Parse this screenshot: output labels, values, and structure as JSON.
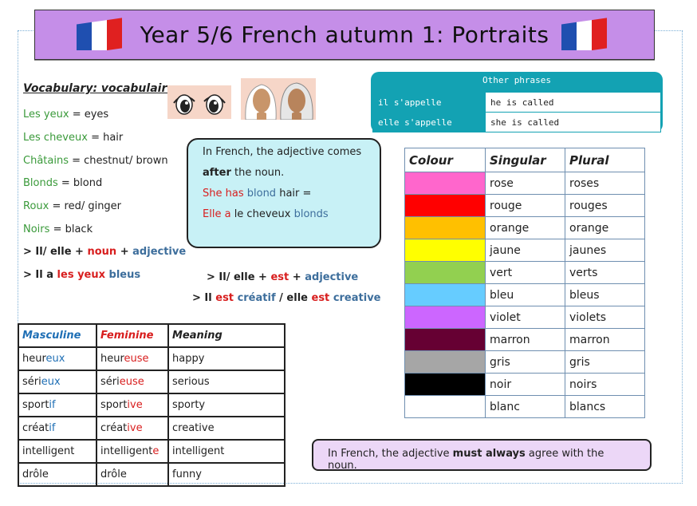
{
  "title": "Year 5/6 French autumn 1: Portraits",
  "vocab": {
    "heading": "Vocabulary: vocabulaire",
    "items": [
      {
        "fr": "Les yeux",
        "en": "= eyes"
      },
      {
        "fr": "Les cheveux",
        "en": "= hair"
      },
      {
        "fr": "Châtains",
        "en": "= chestnut/ brown"
      },
      {
        "fr": "Blonds",
        "en": "= blond"
      },
      {
        "fr": "Roux",
        "en": "= red/ ginger"
      },
      {
        "fr": "Noirs",
        "en": "= black"
      }
    ],
    "rule1": {
      "a": "> Il/ elle +",
      "b": "noun",
      "c": "+",
      "d": "adjective"
    },
    "rule2": {
      "a": "> Il a",
      "b": "les yeux",
      "c": "bleus"
    }
  },
  "callout": {
    "line1": "In French, the adjective comes",
    "line2_bold": "after",
    "line2_rest": "the noun.",
    "ex1_a": "She has",
    "ex1_b": "blond",
    "ex1_c": "hair =",
    "ex2_a": "Elle a",
    "ex2_b": "le cheveux",
    "ex2_c": "blonds"
  },
  "rules2": {
    "r1": {
      "a": "> Il/ elle +",
      "b": "est",
      "c": "+",
      "d": "adjective"
    },
    "r2": {
      "a": "> Il",
      "b": "est",
      "c": "créatif",
      "d": "/ elle",
      "e": "est",
      "f": "creative"
    }
  },
  "other_phrases": {
    "title": "Other phrases",
    "rows": [
      {
        "fr": "il s'appelle",
        "en": "he is called"
      },
      {
        "fr": "elle s'appelle",
        "en": "she is called"
      }
    ]
  },
  "colours": {
    "headers": [
      "Colour",
      "Singular",
      "Plural"
    ],
    "rows": [
      {
        "swatch": "#ff66cc",
        "singular": "rose",
        "plural": "roses"
      },
      {
        "swatch": "#ff0000",
        "singular": "rouge",
        "plural": "rouges"
      },
      {
        "swatch": "#ffc000",
        "singular": "orange",
        "plural": "orange"
      },
      {
        "swatch": "#ffff00",
        "singular": "jaune",
        "plural": "jaunes"
      },
      {
        "swatch": "#92d050",
        "singular": "vert",
        "plural": "verts"
      },
      {
        "swatch": "#66ccff",
        "singular": "bleu",
        "plural": "bleus"
      },
      {
        "swatch": "#cc66ff",
        "singular": "violet",
        "plural": "violets"
      },
      {
        "swatch": "#660033",
        "singular": "marron",
        "plural": "marron"
      },
      {
        "swatch": "#a6a6a6",
        "singular": "gris",
        "plural": "gris"
      },
      {
        "swatch": "#000000",
        "singular": "noir",
        "plural": "noirs"
      },
      {
        "swatch": "#ffffff",
        "singular": "blanc",
        "plural": "blancs"
      }
    ]
  },
  "adjectives": {
    "headers": [
      "Masculine",
      "Feminine",
      "Meaning"
    ],
    "rows": [
      {
        "m_stem": "heur",
        "m_end": "eux",
        "f_stem": "heur",
        "f_end": "euse",
        "meaning": "happy"
      },
      {
        "m_stem": "séri",
        "m_end": "eux",
        "f_stem": "séri",
        "f_end": "euse",
        "meaning": "serious"
      },
      {
        "m_stem": "sport",
        "m_end": "if",
        "f_stem": "sport",
        "f_end": "ive",
        "meaning": "sporty"
      },
      {
        "m_stem": "créat",
        "m_end": "if",
        "f_stem": "créat",
        "f_end": "ive",
        "meaning": "creative"
      },
      {
        "m_stem": "intelligent",
        "m_end": "",
        "f_stem": "intelligent",
        "f_end": "e",
        "meaning": "intelligent"
      },
      {
        "m_stem": "drôle",
        "m_end": "",
        "f_stem": "drôle",
        "f_end": "",
        "meaning": "funny"
      }
    ]
  },
  "agreement": {
    "a": "In French, the adjective",
    "b": "must always",
    "c": "agree with the noun."
  },
  "colors": {
    "title_bg": "#c58ee8",
    "callout_bg": "#c8f1f6",
    "teal": "#13a2b3",
    "vocab_green": "#3a9a3a",
    "fem_red": "#d81e1e",
    "masc_blue": "#1f6fb5"
  }
}
